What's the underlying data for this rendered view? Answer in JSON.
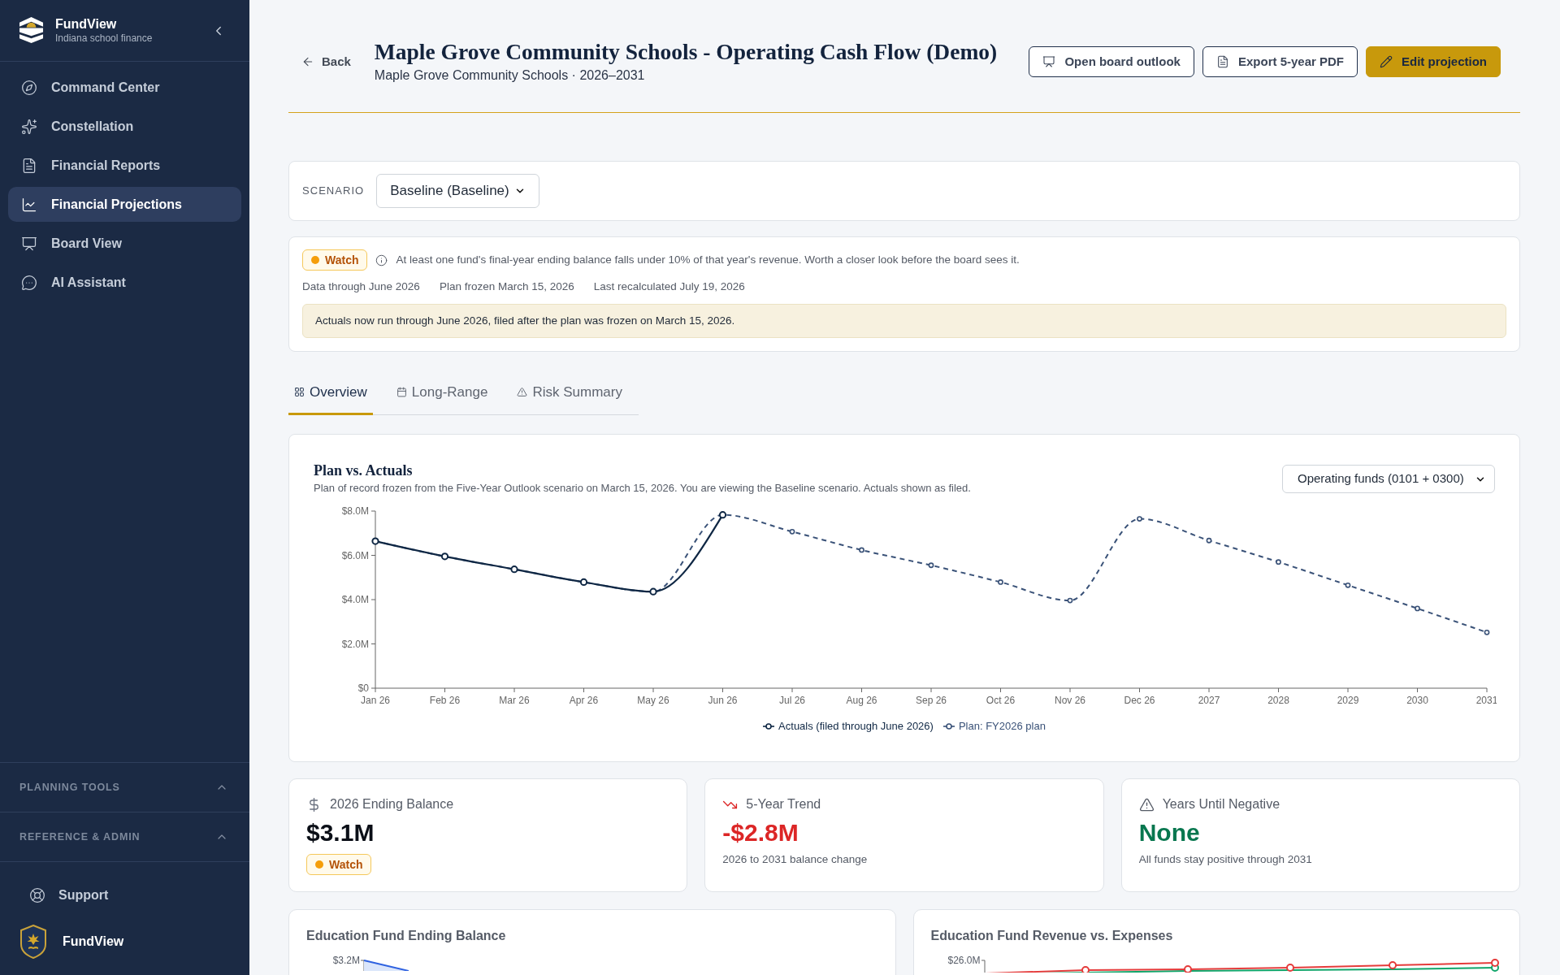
{
  "sidebar": {
    "brand": {
      "name": "FundView",
      "tagline": "Indiana school finance"
    },
    "nav_items": [
      {
        "label": "Command Center",
        "selected": false
      },
      {
        "label": "Constellation",
        "selected": false
      },
      {
        "label": "Financial Reports",
        "selected": false
      },
      {
        "label": "Financial Projections",
        "selected": true
      },
      {
        "label": "Board View",
        "selected": false
      },
      {
        "label": "AI Assistant",
        "selected": false
      }
    ],
    "sections": [
      {
        "label": "PLANNING TOOLS"
      },
      {
        "label": "REFERENCE & ADMIN"
      }
    ],
    "support": {
      "label": "Support"
    },
    "footer_brand": {
      "name": "FundView"
    }
  },
  "header": {
    "back": "Back",
    "title": "Maple Grove Community Schools - Operating Cash Flow (Demo)",
    "subtitle": "Maple Grove Community Schools · 2026–2031",
    "actions": [
      {
        "label": "Open board outlook",
        "kind": "outline"
      },
      {
        "label": "Export 5-year PDF",
        "kind": "outline"
      },
      {
        "label": "Edit projection",
        "kind": "primary"
      }
    ]
  },
  "scenario": {
    "label": "SCENARIO",
    "value": "Baseline (Baseline)"
  },
  "status_panel": {
    "badge": "Watch",
    "message": "At least one fund's final-year ending balance falls under 10% of that year's revenue. Worth a closer look before the board sees it.",
    "meta": [
      "Data through June 2026",
      "Plan frozen March 15, 2026",
      "Last recalculated July 19, 2026"
    ],
    "note": "Actuals now run through June 2026, filed after the plan was frozen on March 15, 2026."
  },
  "tabs": [
    {
      "label": "Overview",
      "selected": true
    },
    {
      "label": "Long-Range",
      "selected": false
    },
    {
      "label": "Risk Summary",
      "selected": false
    }
  ],
  "plan_vs_actuals": {
    "title": "Plan vs. Actuals",
    "subtitle": "Plan of record frozen from the Five-Year Outlook scenario on March 15, 2026. You are viewing the Baseline scenario. Actuals shown as filed.",
    "fund_filter": "Operating funds (0101 + 0300)",
    "chart_data": {
      "type": "line",
      "categories": [
        "Jan 26",
        "Feb 26",
        "Mar 26",
        "Apr 26",
        "May 26",
        "Jun 26",
        "Jul 26",
        "Aug 26",
        "Sep 26",
        "Oct 26",
        "Nov 26",
        "Dec 26",
        "2027",
        "2028",
        "2029",
        "2030",
        "2031"
      ],
      "series": [
        {
          "name": "Actuals (filed through June 2026)",
          "color": "#0f2744",
          "line_style": "solid",
          "marker": "circle",
          "values": [
            6.64,
            5.95,
            5.37,
            4.79,
            4.36,
            7.83,
            null,
            null,
            null,
            null,
            null,
            null,
            null,
            null,
            null,
            null,
            null
          ]
        },
        {
          "name": "Plan: FY2026 plan",
          "color": "#3a5278",
          "line_style": "dashed",
          "marker": "circle",
          "values": [
            6.64,
            5.95,
            5.37,
            4.79,
            4.36,
            7.83,
            7.07,
            6.24,
            5.55,
            4.79,
            3.96,
            7.65,
            6.67,
            5.7,
            4.65,
            3.6,
            2.52
          ]
        }
      ],
      "ylim": [
        0,
        8
      ],
      "yticks": [
        {
          "value": 0,
          "label": "$0"
        },
        {
          "value": 2,
          "label": "$2.0M"
        },
        {
          "value": 4,
          "label": "$4.0M"
        },
        {
          "value": 6,
          "label": "$6.0M"
        },
        {
          "value": 8,
          "label": "$8.0M"
        }
      ],
      "legend": "bottom"
    }
  },
  "kpis": [
    {
      "label": "2026 Ending Balance",
      "value": "$3.1M",
      "color": "#0b0f17",
      "badge": "Watch"
    },
    {
      "label": "5-Year Trend",
      "value": "-$2.8M",
      "color": "#dc2626",
      "note": "2026 to 2031 balance change"
    },
    {
      "label": "Years Until Negative",
      "value": "None",
      "color": "#08774f",
      "note": "All funds stay positive through 2031"
    }
  ],
  "bottom_charts": [
    {
      "title": "Education Fund Ending Balance",
      "y_tick": "$3.2M"
    },
    {
      "title": "Education Fund Revenue vs. Expenses",
      "y_tick": "$26.0M"
    }
  ]
}
